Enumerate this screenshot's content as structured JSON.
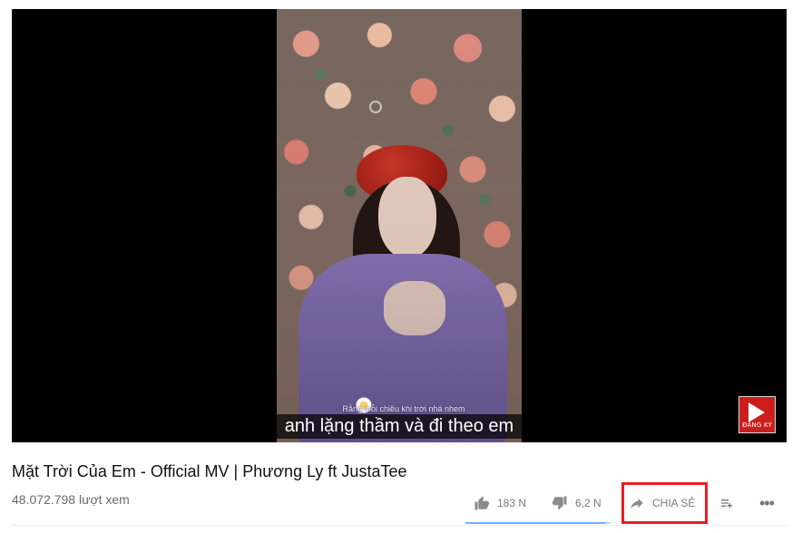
{
  "video": {
    "subtitle_small": "Rằng mỗi chiều khi trời nhá nhem",
    "subtitle_main": "anh lặng thầm và đi theo em",
    "subscribe_label": "ĐĂNG KÝ"
  },
  "details": {
    "title": "Mặt Trời Của Em - Official MV | Phương Ly ft JustaTee",
    "views": "48.072.798 lượt xem"
  },
  "actions": {
    "likes": "183 N",
    "dislikes": "6,2 N",
    "share": "CHIA SẺ",
    "like_ratio": 0.967
  },
  "icons": {
    "like": "thumb-up-icon",
    "dislike": "thumb-down-icon",
    "share": "share-arrow-icon",
    "playlist": "add-to-playlist-icon",
    "more": "more-options-icon",
    "subscribe": "play-icon"
  },
  "colors": {
    "highlight": "#ec1c24",
    "sentiment_fill": "#6db0ff",
    "subscribe_bg": "#cc1d1d"
  }
}
